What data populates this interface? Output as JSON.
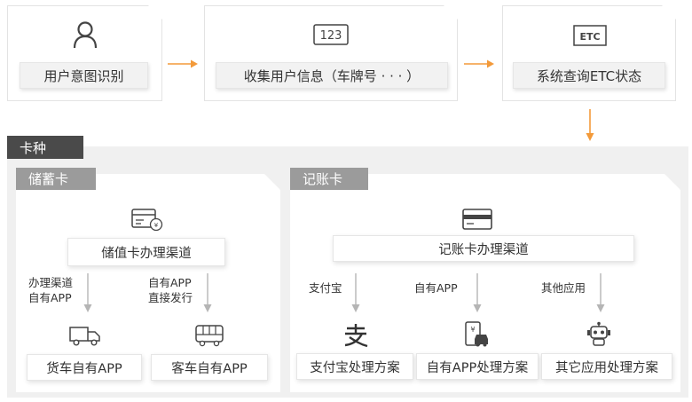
{
  "top_steps": [
    {
      "label": "用户意图识别",
      "icon": "user-icon"
    },
    {
      "label": "收集用户信息（车牌号 · · · ）",
      "icon": "number-123-icon"
    },
    {
      "label": "系统查询ETC状态",
      "icon": "etc-icon",
      "icon_text": "ETC"
    }
  ],
  "card_type": {
    "title": "卡种",
    "savings": {
      "title": "储蓄卡",
      "channel_label": "储值卡办理渠道",
      "branches": [
        {
          "arrow_label": "办理渠道\n自有APP",
          "target": "货车自有APP",
          "icon": "truck-icon"
        },
        {
          "arrow_label": "自有APP\n直接发行",
          "target": "客车自有APP",
          "icon": "bus-icon"
        }
      ]
    },
    "credit": {
      "title": "记账卡",
      "channel_label": "记账卡办理渠道",
      "branches": [
        {
          "arrow_label": "支付宝",
          "target": "支付宝处理方案",
          "icon": "alipay-icon"
        },
        {
          "arrow_label": "自有APP",
          "target": "自有APP处理方案",
          "icon": "phone-car-icon"
        },
        {
          "arrow_label": "其他应用",
          "target": "其它应用处理方案",
          "icon": "robot-icon"
        }
      ]
    }
  },
  "colors": {
    "accent": "#f39a3a",
    "dark_tab": "#4a4a4a",
    "grey_tab": "#9b9b9b",
    "region": "#f0f0f0",
    "down_arrow": "#b5b5b5"
  }
}
